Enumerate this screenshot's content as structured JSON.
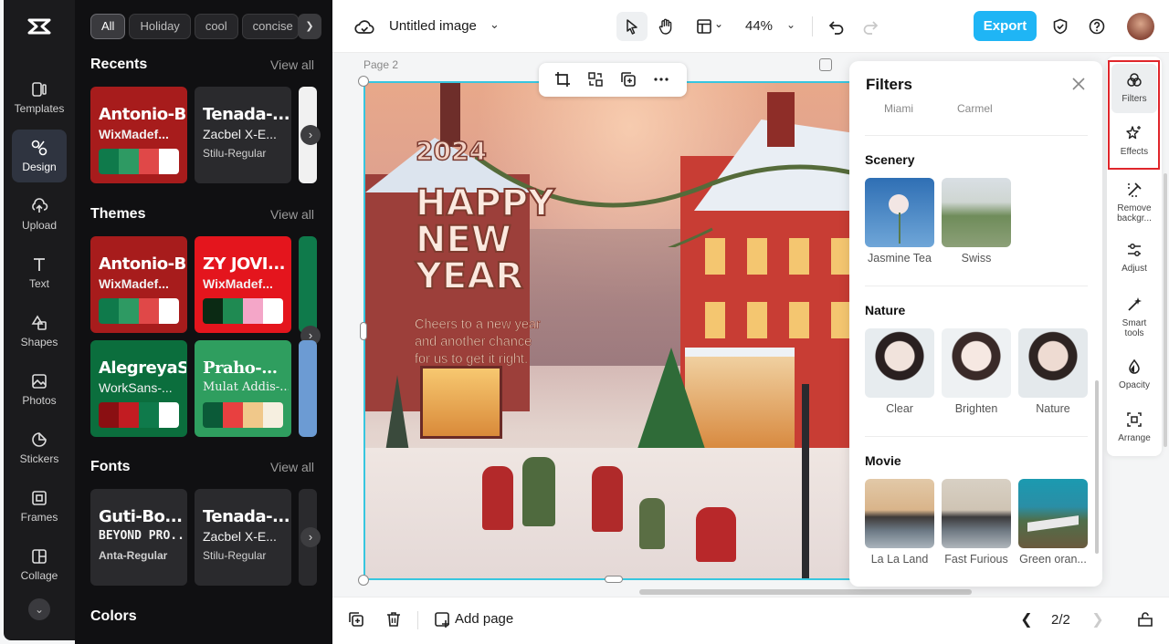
{
  "app": {
    "title": "Untitled image",
    "zoom": "44%",
    "export_label": "Export",
    "accent": "#1fb5f5"
  },
  "rail": {
    "items": [
      {
        "label": "Templates",
        "icon": "templates-icon"
      },
      {
        "label": "Design",
        "icon": "design-icon"
      },
      {
        "label": "Upload",
        "icon": "upload-icon"
      },
      {
        "label": "Text",
        "icon": "text-icon"
      },
      {
        "label": "Shapes",
        "icon": "shapes-icon"
      },
      {
        "label": "Photos",
        "icon": "photos-icon"
      },
      {
        "label": "Stickers",
        "icon": "stickers-icon"
      },
      {
        "label": "Frames",
        "icon": "frames-icon"
      },
      {
        "label": "Collage",
        "icon": "collage-icon"
      }
    ]
  },
  "panel": {
    "chips": [
      "All",
      "Holiday",
      "cool",
      "concise"
    ],
    "view_all": "View all",
    "recents": {
      "title": "Recents",
      "cards": [
        {
          "line1": "Antonio-Bold",
          "line2": "WixMadef...",
          "bg": "#a71c1c",
          "swatches": [
            "#0f7a4b",
            "#2e9a63",
            "#e04848",
            "#ffffff"
          ]
        },
        {
          "line1": "Tenada-...",
          "line2": "Zacbel X-E...",
          "line3": "Stilu-Regular",
          "bg": "#2a2a2d"
        }
      ]
    },
    "themes": {
      "title": "Themes",
      "cards": [
        {
          "line1": "Antonio-Bold",
          "line2": "WixMadef...",
          "bg": "#a71c1c",
          "swatches": [
            "#0f7a4b",
            "#2e9a63",
            "#e04848",
            "#ffffff"
          ]
        },
        {
          "line1": "ZY JOVI...",
          "line2": "WixMadef...",
          "bg": "#e4151d",
          "swatches": [
            "#0b2a14",
            "#1f8a52",
            "#f4a6c8",
            "#ffffff"
          ]
        },
        {
          "line1": "AlegreyaS...",
          "line2": "WorkSans-...",
          "bg": "#0b6e3d",
          "swatches": [
            "#8a0f12",
            "#c21c22",
            "#0f7a4b",
            "#ffffff"
          ]
        },
        {
          "line1": "Praho-...",
          "line2": "Mulat Addis-...",
          "bg": "#2f9e5f",
          "swatches": [
            "#0b5a38",
            "#e84040",
            "#f0c88a",
            "#f6efe0"
          ]
        }
      ]
    },
    "fonts": {
      "title": "Fonts",
      "cards": [
        {
          "line1": "Guti-Bo...",
          "line2": "BEYOND PRO...",
          "line3": "Anta-Regular",
          "bg": "#2a2a2d"
        },
        {
          "line1": "Tenada-...",
          "line2": "Zacbel X-E...",
          "line3": "Stilu-Regular",
          "bg": "#2a2a2d"
        }
      ]
    },
    "colors": {
      "title": "Colors"
    }
  },
  "canvas": {
    "page_label": "Page 2",
    "art": {
      "year": "2024",
      "headline": [
        "HAPPY",
        "NEW",
        "YEAR"
      ],
      "caption": [
        "Cheers to a new year",
        "and another chance",
        "for us to get it right."
      ]
    }
  },
  "filters": {
    "title": "Filters",
    "cut_labels": [
      "Miami",
      "Carmel"
    ],
    "sections": [
      {
        "title": "Scenery",
        "items": [
          {
            "label": "Jasmine Tea",
            "bg": "#3a6aa8"
          },
          {
            "label": "Swiss",
            "bg": "#8aa07a"
          }
        ]
      },
      {
        "title": "Nature",
        "items": [
          {
            "label": "Clear",
            "bg": "#d8d2cf"
          },
          {
            "label": "Brighten",
            "bg": "#ded8d5"
          },
          {
            "label": "Nature",
            "bg": "#d6d0cc"
          }
        ]
      },
      {
        "title": "Movie",
        "items": [
          {
            "label": "La La Land",
            "bg": "#3d3f46"
          },
          {
            "label": "Fast Furious",
            "bg": "#4a4d52"
          },
          {
            "label": "Green oran...",
            "bg": "#1a8aa0"
          }
        ]
      }
    ]
  },
  "right_tools": [
    {
      "label": "Filters",
      "icon": "filters-icon"
    },
    {
      "label": "Effects",
      "icon": "effects-icon"
    },
    {
      "label": "Remove backgr...",
      "icon": "remove-background-icon"
    },
    {
      "label": "Adjust",
      "icon": "adjust-icon"
    },
    {
      "label": "Smart tools",
      "icon": "smart-tools-icon"
    },
    {
      "label": "Opacity",
      "icon": "opacity-icon"
    },
    {
      "label": "Arrange",
      "icon": "arrange-icon"
    }
  ],
  "bottom": {
    "add_page": "Add page",
    "page_indicator": "2/2"
  }
}
